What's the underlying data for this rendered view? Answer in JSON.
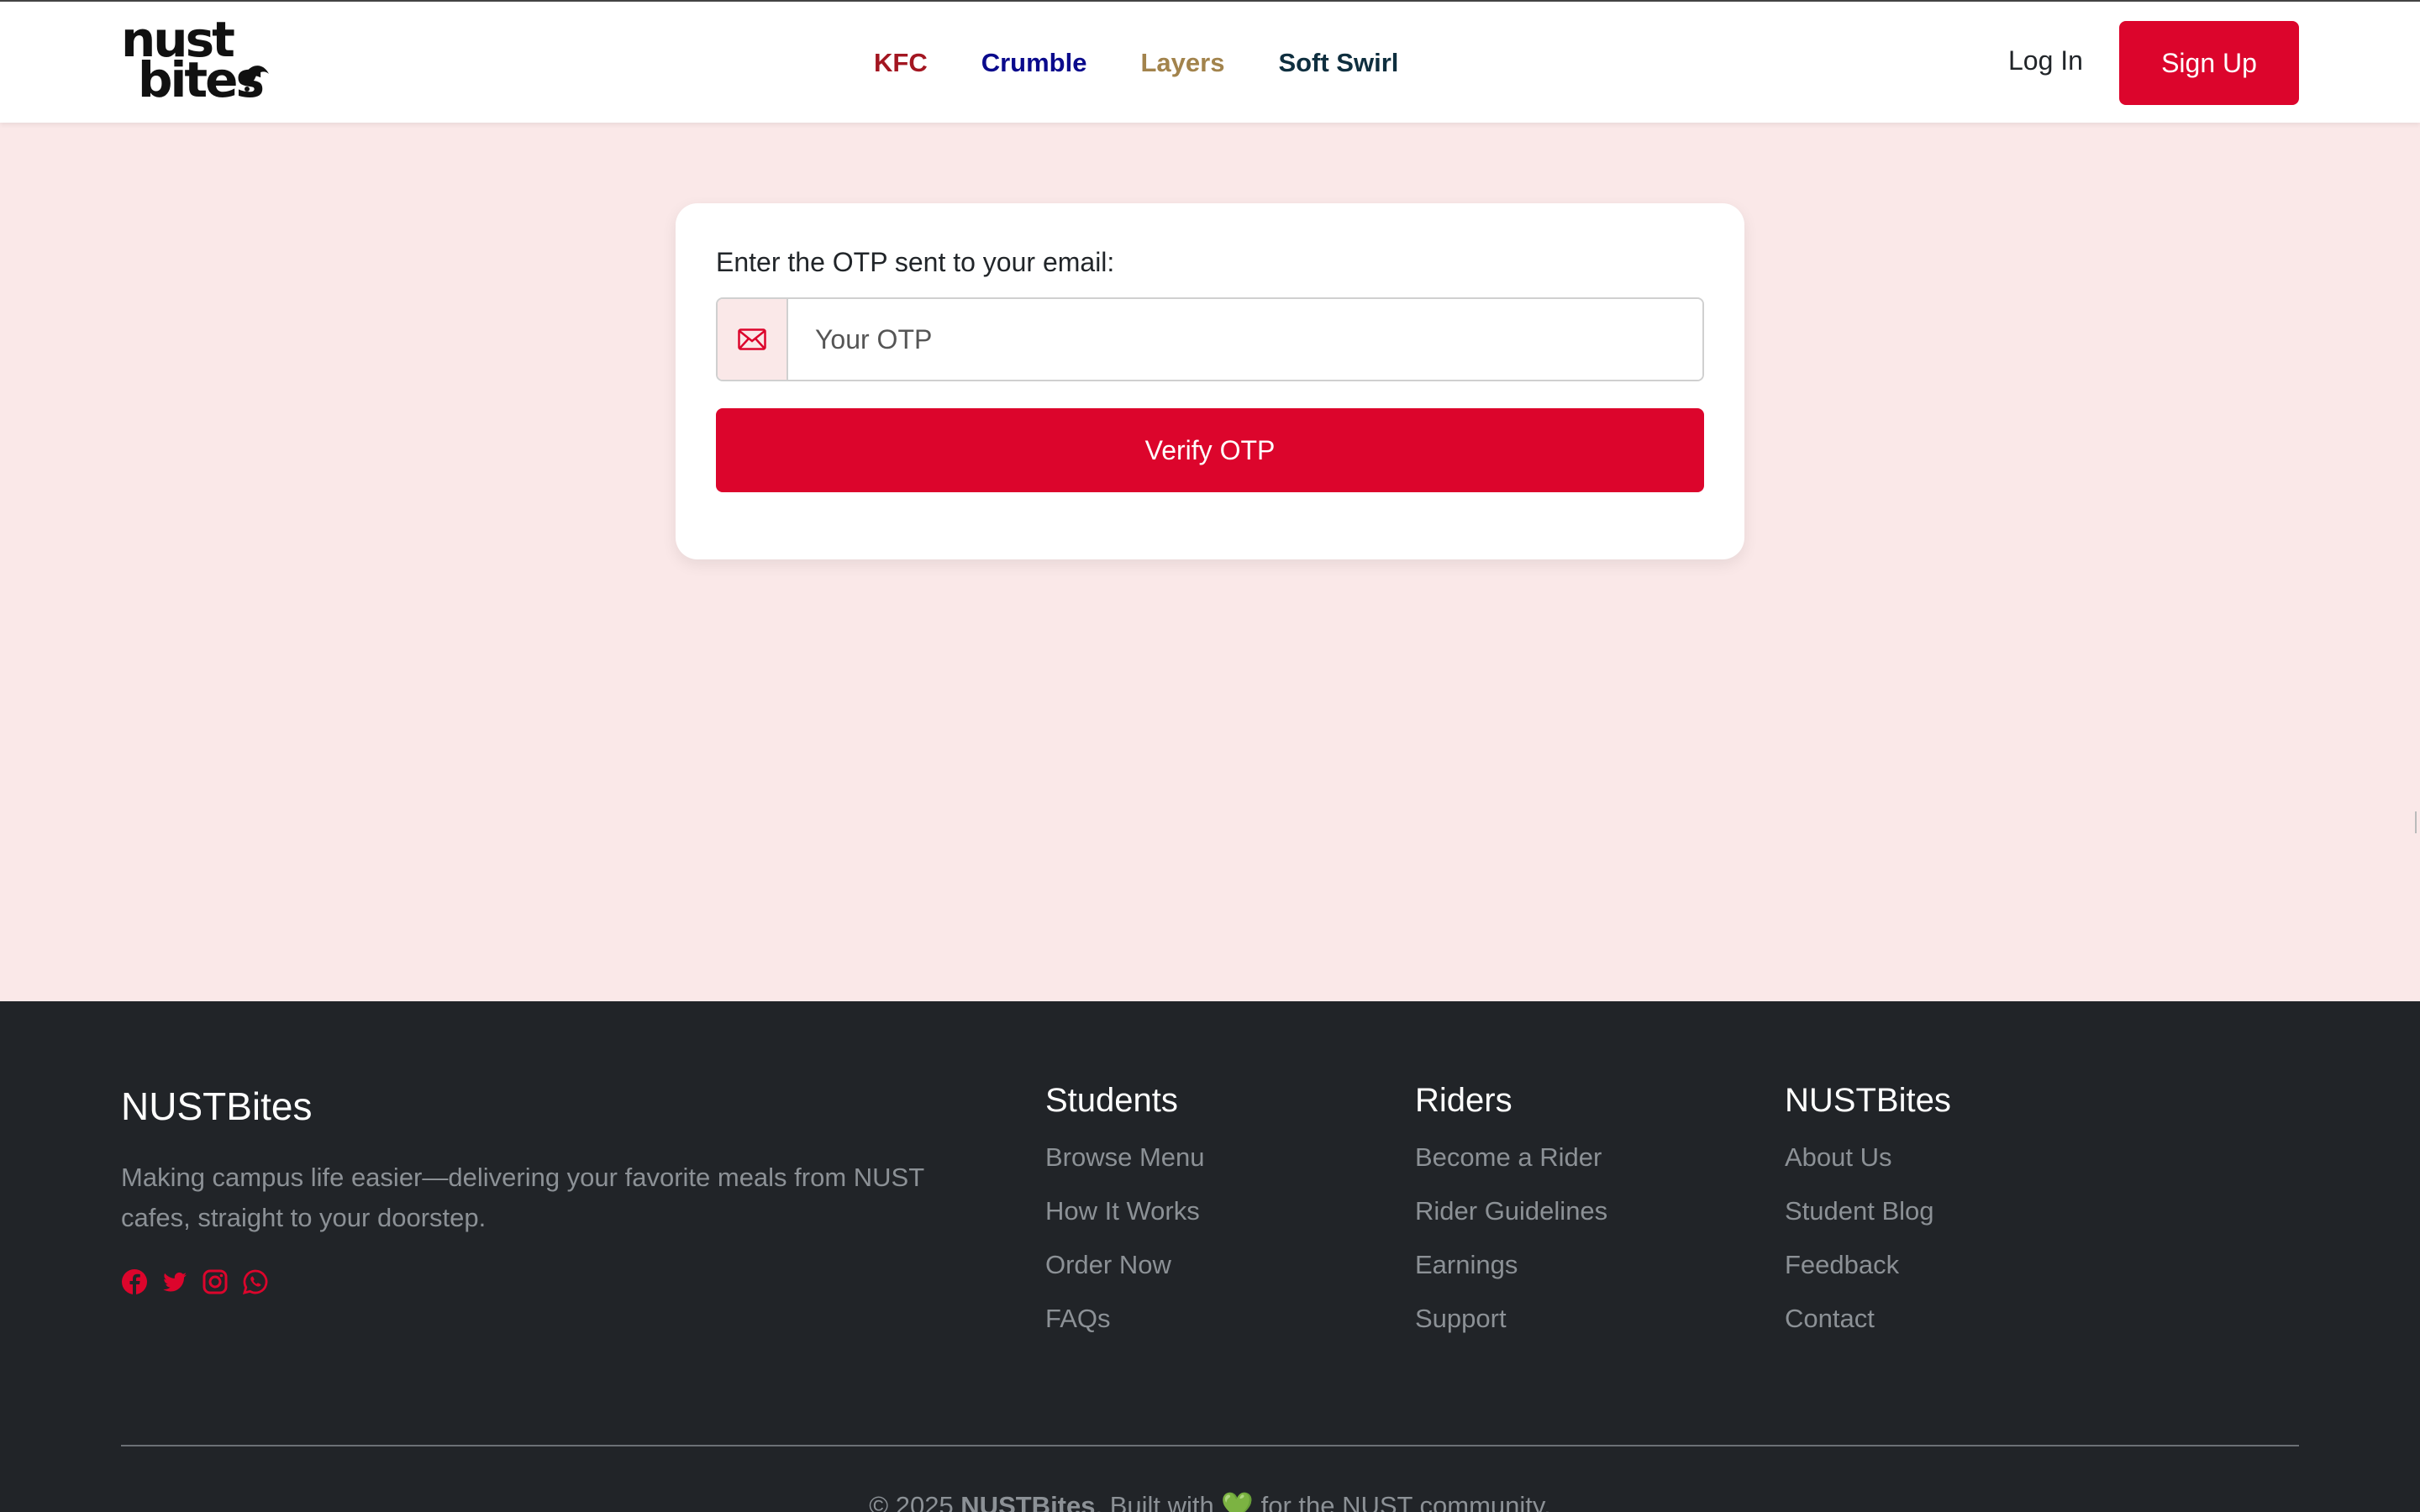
{
  "nav": {
    "logo_line1": "nust",
    "logo_line2": "bites",
    "links": [
      {
        "label": "KFC",
        "color": "#a31621"
      },
      {
        "label": "Crumble",
        "color": "#0a0a8c"
      },
      {
        "label": "Layers",
        "color": "#a2834c"
      },
      {
        "label": "Soft Swirl",
        "color": "#0f2f3f"
      }
    ],
    "login_label": "Log In",
    "signup_label": "Sign Up"
  },
  "otp": {
    "label": "Enter the OTP sent to your email:",
    "placeholder": "Your OTP",
    "value": "",
    "icon": "envelope-icon",
    "verify_label": "Verify OTP"
  },
  "footer": {
    "brand_title": "NUSTBites",
    "brand_desc": "Making campus life easier—delivering your favorite meals from NUST cafes, straight to your doorstep.",
    "socials": [
      "facebook-icon",
      "twitter-icon",
      "instagram-icon",
      "whatsapp-icon"
    ],
    "columns": [
      {
        "title": "Students",
        "items": [
          "Browse Menu",
          "How It Works",
          "Order Now",
          "FAQs"
        ]
      },
      {
        "title": "Riders",
        "items": [
          "Become a Rider",
          "Rider Guidelines",
          "Earnings",
          "Support"
        ]
      },
      {
        "title": "NUSTBites",
        "items": [
          "About Us",
          "Student Blog",
          "Feedback",
          "Contact"
        ]
      }
    ],
    "copyright_prefix": "© 2025 ",
    "copyright_brand": "NUSTBites",
    "copyright_suffix": ". Built with 💚 for the NUST community."
  },
  "colors": {
    "accent": "#dc052c",
    "page_bg": "#fae8e8",
    "footer_bg": "#212428"
  }
}
